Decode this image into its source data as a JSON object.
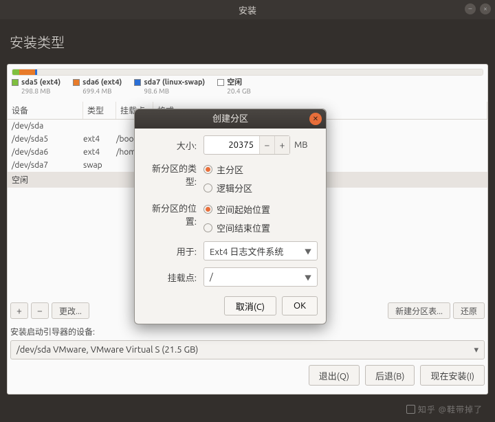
{
  "window": {
    "title": "安装"
  },
  "page": {
    "title": "安装类型"
  },
  "disk_segments": [
    {
      "color": "#7fbf3f",
      "pct": 1.5
    },
    {
      "color": "#e87b2a",
      "pct": 3.3
    },
    {
      "color": "#2a6fd6",
      "pct": 0.5
    },
    {
      "color": "#eceae6",
      "pct": 94.7
    }
  ],
  "legend": [
    {
      "color": "#7fbf3f",
      "name": "sda5 (ext4)",
      "size": "298.8 MB"
    },
    {
      "color": "#e87b2a",
      "name": "sda6 (ext4)",
      "size": "699.4 MB"
    },
    {
      "color": "#2a6fd6",
      "name": "sda7 (linux-swap)",
      "size": "98.6 MB"
    },
    {
      "color": "#ffffff",
      "name": "空闲",
      "size": "20.4 GB"
    }
  ],
  "table": {
    "headers": {
      "device": "设备",
      "type": "类型",
      "mount": "挂载点",
      "format": "格式"
    },
    "rows": [
      {
        "device": "/dev/sda",
        "type": "",
        "mount": ""
      },
      {
        "device": " /dev/sda5",
        "type": "ext4",
        "mount": "/boot"
      },
      {
        "device": " /dev/sda6",
        "type": "ext4",
        "mount": "/home"
      },
      {
        "device": " /dev/sda7",
        "type": "swap",
        "mount": ""
      },
      {
        "device": " 空闲",
        "type": "",
        "mount": "",
        "selected": true
      }
    ]
  },
  "table_buttons": {
    "add": "+",
    "remove": "−",
    "change": "更改...",
    "new_table": "新建分区表...",
    "revert": "还原"
  },
  "boot": {
    "label": "安装启动引导器的设备:",
    "value": "/dev/sda   VMware, VMware Virtual S (21.5 GB)"
  },
  "wizard": {
    "quit": "退出(Q)",
    "back": "后退(B)",
    "install": "现在安装(I)"
  },
  "modal": {
    "title": "创建分区",
    "size_label": "大小:",
    "size_value": "20375",
    "size_unit": "MB",
    "type_label": "新分区的类型:",
    "type_opts": {
      "primary": "主分区",
      "logical": "逻辑分区"
    },
    "loc_label": "新分区的位置:",
    "loc_opts": {
      "begin": "空间起始位置",
      "end": "空间结束位置"
    },
    "use_label": "用于:",
    "use_value": "Ext4 日志文件系统",
    "mount_label": "挂载点:",
    "mount_value": "/",
    "cancel": "取消(C)",
    "ok": "OK"
  },
  "watermark": "知乎 @鞋带掉了"
}
